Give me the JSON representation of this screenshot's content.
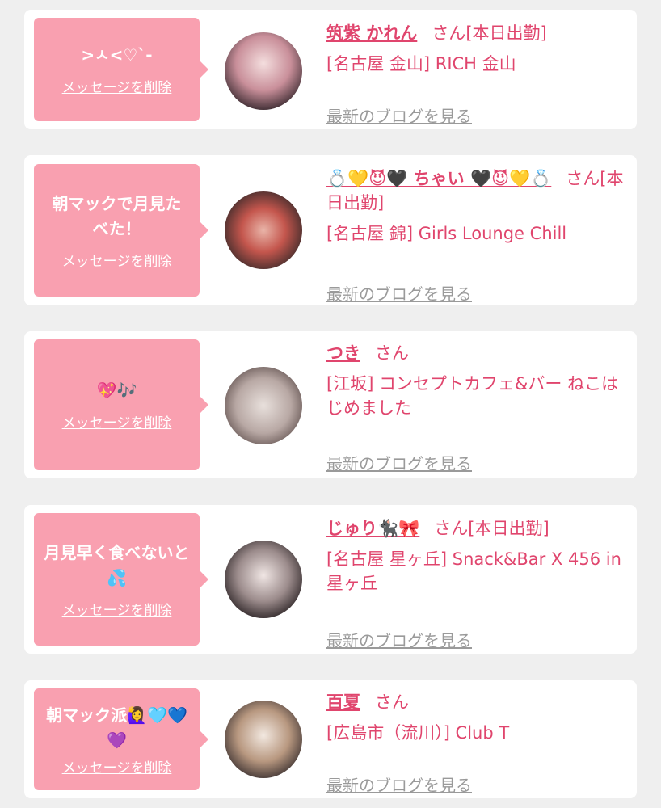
{
  "cards": [
    {
      "message": ">ㅅ<♡`-",
      "delete_label": "メッセージを削除",
      "name": "筑紫 かれん",
      "san": "さん",
      "status": "[本日出勤]",
      "shop": "[名古屋 金山] RICH 金山",
      "blog_label": "最新のブログを見る"
    },
    {
      "message": "朝マックで月見たべた！",
      "delete_label": "メッセージを削除",
      "name": "💍💛😈🖤 ちゃい 🖤😈💛💍",
      "san": "さん",
      "status": "[本日出勤]",
      "shop": "[名古屋 錦] Girls Lounge Chill",
      "blog_label": "最新のブログを見る"
    },
    {
      "message": "💖🎶",
      "delete_label": "メッセージを削除",
      "name": "つき",
      "san": "さん",
      "status": "",
      "shop": "[江坂] コンセプトカフェ&バー ねこはじめました",
      "blog_label": "最新のブログを見る"
    },
    {
      "message": "月見早く食べないと💦",
      "delete_label": "メッセージを削除",
      "name": "じゅり🐈‍⬛🎀",
      "san": "さん",
      "status": "[本日出勤]",
      "shop": "[名古屋 星ヶ丘] Snack&Bar X 456 in 星ヶ丘",
      "blog_label": "最新のブログを見る"
    },
    {
      "message": "朝マック派🙋‍♀️🩵💙💜",
      "delete_label": "メッセージを削除",
      "name": "百夏",
      "san": "さん",
      "status": "",
      "shop": "[広島市（流川）] Club T",
      "blog_label": "最新のブログを見る"
    }
  ],
  "colors": {
    "accent": "#e0456d",
    "bubble": "#f9a0b0",
    "background": "#efefef"
  }
}
